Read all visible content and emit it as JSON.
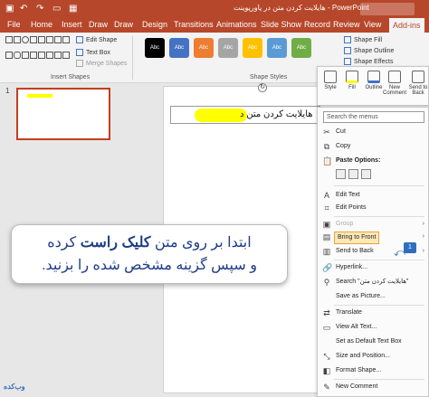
{
  "titlebar": {
    "title": "هایلایت کردن متن در پاورپوینت",
    "app": "PowerPoint",
    "qa_icons": [
      "save-icon",
      "undo-icon",
      "redo-icon",
      "present-icon",
      "layout-icon"
    ]
  },
  "tabs": [
    "File",
    "Home",
    "Insert",
    "Draw",
    "Draw",
    "Design",
    "Transitions",
    "Animations",
    "Slide Show",
    "Record",
    "Review",
    "View",
    "Add-ins"
  ],
  "ribbon": {
    "edit_shape": "Edit Shape",
    "text_box": "Text Box",
    "merge_shapes": "Merge Shapes",
    "insert_shapes_label": "Insert Shapes",
    "style_label": "Abc",
    "shape_styles_label": "Shape Styles",
    "shape_fill": "Shape Fill",
    "shape_outline": "Shape Outline",
    "shape_effects": "Shape Effects",
    "style_colors": [
      "#000000",
      "#4472c4",
      "#ed7d31",
      "#a5a5a5",
      "#ffc000",
      "#5b9bd5",
      "#70ad47"
    ]
  },
  "slide_panel": {
    "number": "1"
  },
  "slide": {
    "text": "هایلایت کردن متن د"
  },
  "mini_toolbar": {
    "style": "Style",
    "fill": "Fill",
    "outline": "Outline",
    "new_comment": "New Comment",
    "send_to_back": "Send to Back"
  },
  "context_menu": {
    "search_placeholder": "Search the menus",
    "cut": "Cut",
    "copy": "Copy",
    "paste_options": "Paste Options:",
    "edit_text": "Edit Text",
    "edit_points": "Edit Points",
    "group": "Group",
    "bring_to_front": "Bring to Front",
    "send_to_back": "Send to Back",
    "hyperlink": "Hyperlink...",
    "search_item": "Search \"هایلایت کردن متن\"",
    "save_as_picture": "Save as Picture...",
    "translate": "Translate",
    "view_alt_text": "View Alt Text...",
    "set_default_text_box": "Set as Default Text Box",
    "size_position": "Size and Position...",
    "format_shape": "Format Shape...",
    "new_comment": "New Comment"
  },
  "callout": {
    "line1_pre": "ابتدا بر روی متن ",
    "line1_bold": "کلیک راست",
    "line1_post": " کرده",
    "line2": "و سپس گزینه مشخص شده را بزنید."
  },
  "badge": "1",
  "logo": "وب‌کده"
}
